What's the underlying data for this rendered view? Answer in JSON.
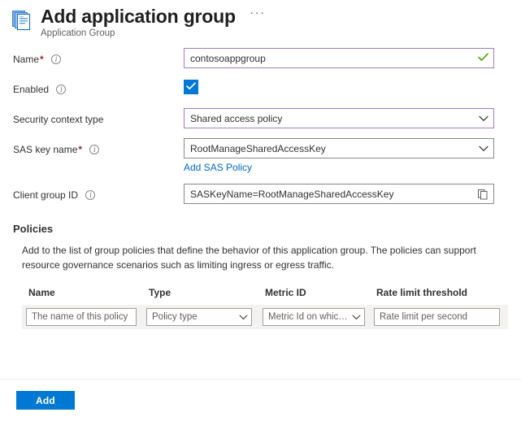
{
  "header": {
    "title": "Add application group",
    "subtitle": "Application Group",
    "icon": "application-group-icon",
    "more_menu": "···"
  },
  "form": {
    "fields": [
      {
        "label": "Name",
        "required": true,
        "has_info": true,
        "control": "textbox",
        "value": "contosoappgroup",
        "state": "valid",
        "suffix_icon": "green-check-icon"
      },
      {
        "label": "Enabled",
        "required": false,
        "has_info": true,
        "control": "checkbox",
        "checked": true
      },
      {
        "label": "Security context type",
        "required": false,
        "has_info": false,
        "control": "dropdown",
        "value": "Shared access policy",
        "state": "valid"
      },
      {
        "label": "SAS key name",
        "required": true,
        "has_info": true,
        "control": "dropdown",
        "value": "RootManageSharedAccessKey",
        "state": "default",
        "sublink": "Add SAS Policy"
      },
      {
        "label": "Client group ID",
        "required": false,
        "has_info": true,
        "control": "textbox",
        "value": "SASKeyName=RootManageSharedAccessKey",
        "state": "default",
        "suffix_icon": "copy-icon"
      }
    ]
  },
  "policies": {
    "title": "Policies",
    "description": "Add to the list of group policies that define the behavior of this application group. The policies can support resource governance scenarios such as limiting ingress or egress traffic.",
    "table": {
      "columns": [
        "Name",
        "Type",
        "Metric ID",
        "Rate limit threshold"
      ],
      "rows": [
        {
          "name_placeholder": "The name of this policy",
          "type_placeholder": "Policy type",
          "metric_placeholder": "Metric Id on which ...",
          "rate_placeholder": "Rate limit per second"
        }
      ]
    }
  },
  "footer": {
    "add_label": "Add"
  },
  "colors": {
    "accent": "#0078d4",
    "valid_border": "#a27cc0",
    "link": "#0066cc",
    "required": "#a4262c",
    "success_check": "#4ca20b",
    "row_bg": "#f3f2f1"
  }
}
